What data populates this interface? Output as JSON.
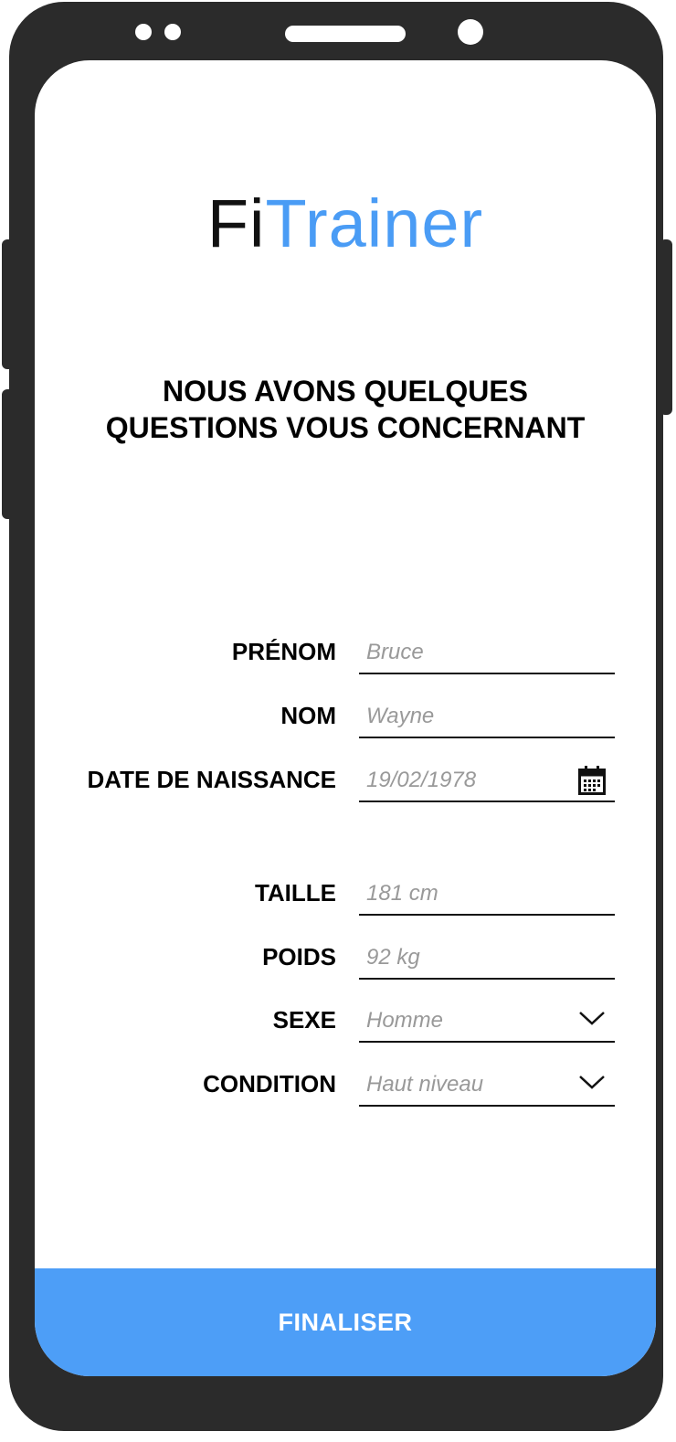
{
  "app": {
    "logo_part1": "Fi",
    "logo_part2": "Trainer"
  },
  "headline": {
    "line1": "NOUS AVONS QUELQUES",
    "line2": "QUESTIONS VOUS CONCERNANT"
  },
  "form": {
    "prenom": {
      "label": "PRÉNOM",
      "placeholder": "Bruce"
    },
    "nom": {
      "label": "NOM",
      "placeholder": "Wayne"
    },
    "date": {
      "label": "DATE DE NAISSANCE",
      "placeholder": "19/02/1978",
      "icon": "calendar-icon"
    },
    "taille": {
      "label": "TAILLE",
      "placeholder": "181 cm"
    },
    "poids": {
      "label": "POIDS",
      "placeholder": "92 kg"
    },
    "sexe": {
      "label": "SEXE",
      "value": "Homme",
      "icon": "chevron-down-icon"
    },
    "condition": {
      "label": "CONDITION",
      "value": "Haut niveau",
      "icon": "chevron-down-icon"
    }
  },
  "submit": {
    "label": "FINALISER"
  },
  "colors": {
    "accent": "#4D9EF7",
    "device": "#2B2B2B",
    "placeholder": "#999999"
  }
}
